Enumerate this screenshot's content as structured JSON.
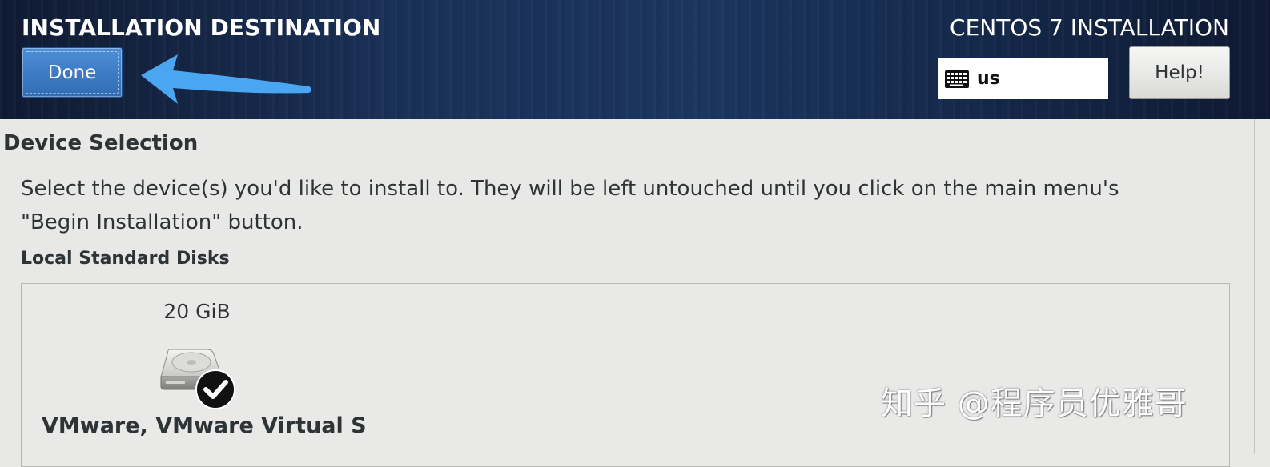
{
  "header": {
    "spoke_title": "INSTALLATION DESTINATION",
    "done_label": "Done",
    "product_title": "CENTOS 7 INSTALLATION",
    "keyboard_layout": "us",
    "keyboard_icon": "keyboard-icon",
    "help_label": "Help!"
  },
  "annotation": {
    "arrow_icon": "arrow-left-icon",
    "arrow_color": "#4aa6f0"
  },
  "device_selection": {
    "title": "Device Selection",
    "instructions_line1": "Select the device(s) you'd like to install to.  They will be left untouched until you click on the main menu's",
    "instructions_line2": "\"Begin Installation\" button.",
    "local_disks_title": "Local Standard Disks",
    "disks": [
      {
        "size": "20 GiB",
        "name": "VMware, VMware Virtual S",
        "icon": "hard-disk-icon",
        "selected_icon": "checkmark-icon",
        "selected": true
      }
    ]
  },
  "watermark": {
    "text": "知乎 @程序员优雅哥"
  },
  "colors": {
    "header_bg": "#1a3056",
    "done_button": "#3c7bc4",
    "content_bg": "#e8e8e7",
    "text": "#2e3436"
  }
}
